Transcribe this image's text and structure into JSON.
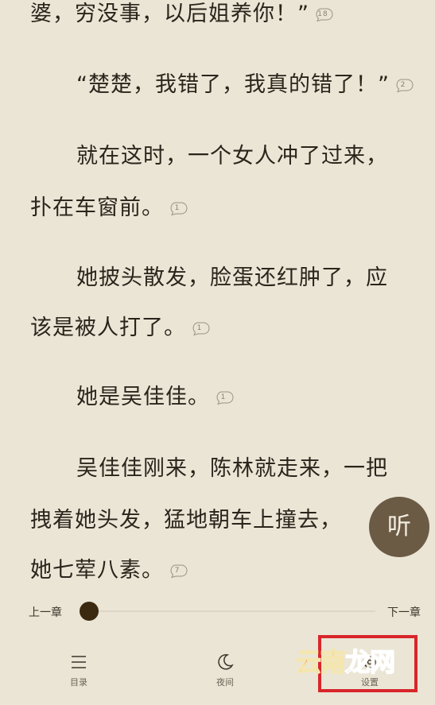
{
  "reader": {
    "paragraphs": [
      {
        "text": "婆，穷没事，以后姐养你！”",
        "comments": "18"
      },
      {
        "text": "“楚楚，我错了，我真的错了！”",
        "comments": "2"
      },
      {
        "text": "就在这时，一个女人冲了过来，",
        "comments": ""
      },
      {
        "text": "扑在车窗前。",
        "comments": "1"
      },
      {
        "text": "她披头散发，脸蛋还红肿了，应",
        "comments": ""
      },
      {
        "text": "该是被人打了。",
        "comments": "1"
      },
      {
        "text": "她是吴佳佳。",
        "comments": "1"
      },
      {
        "text": "吴佳佳刚来，陈林就走来，一把",
        "comments": ""
      },
      {
        "text": "拽着她头发，猛地朝车上撞去，",
        "comments": ""
      },
      {
        "text": "她七荤八素。",
        "comments": "7"
      }
    ]
  },
  "listen_button": {
    "label": "听"
  },
  "chapter_nav": {
    "prev_label": "上一章",
    "next_label": "下一章",
    "progress": 0.0
  },
  "toolbar": {
    "toc": {
      "label": "目录",
      "icon": "menu-icon"
    },
    "night": {
      "label": "夜间",
      "icon": "moon-icon"
    },
    "settings": {
      "label": "设置",
      "icon": "gear-icon"
    }
  },
  "watermark": {
    "part1": "云南",
    "part2": "龙网"
  },
  "colors": {
    "background": "#ebe5d6",
    "text": "#2a241b",
    "listen_button": "#6b5b45",
    "progress_knob": "#3b2a10",
    "highlight": "#d8262a"
  }
}
